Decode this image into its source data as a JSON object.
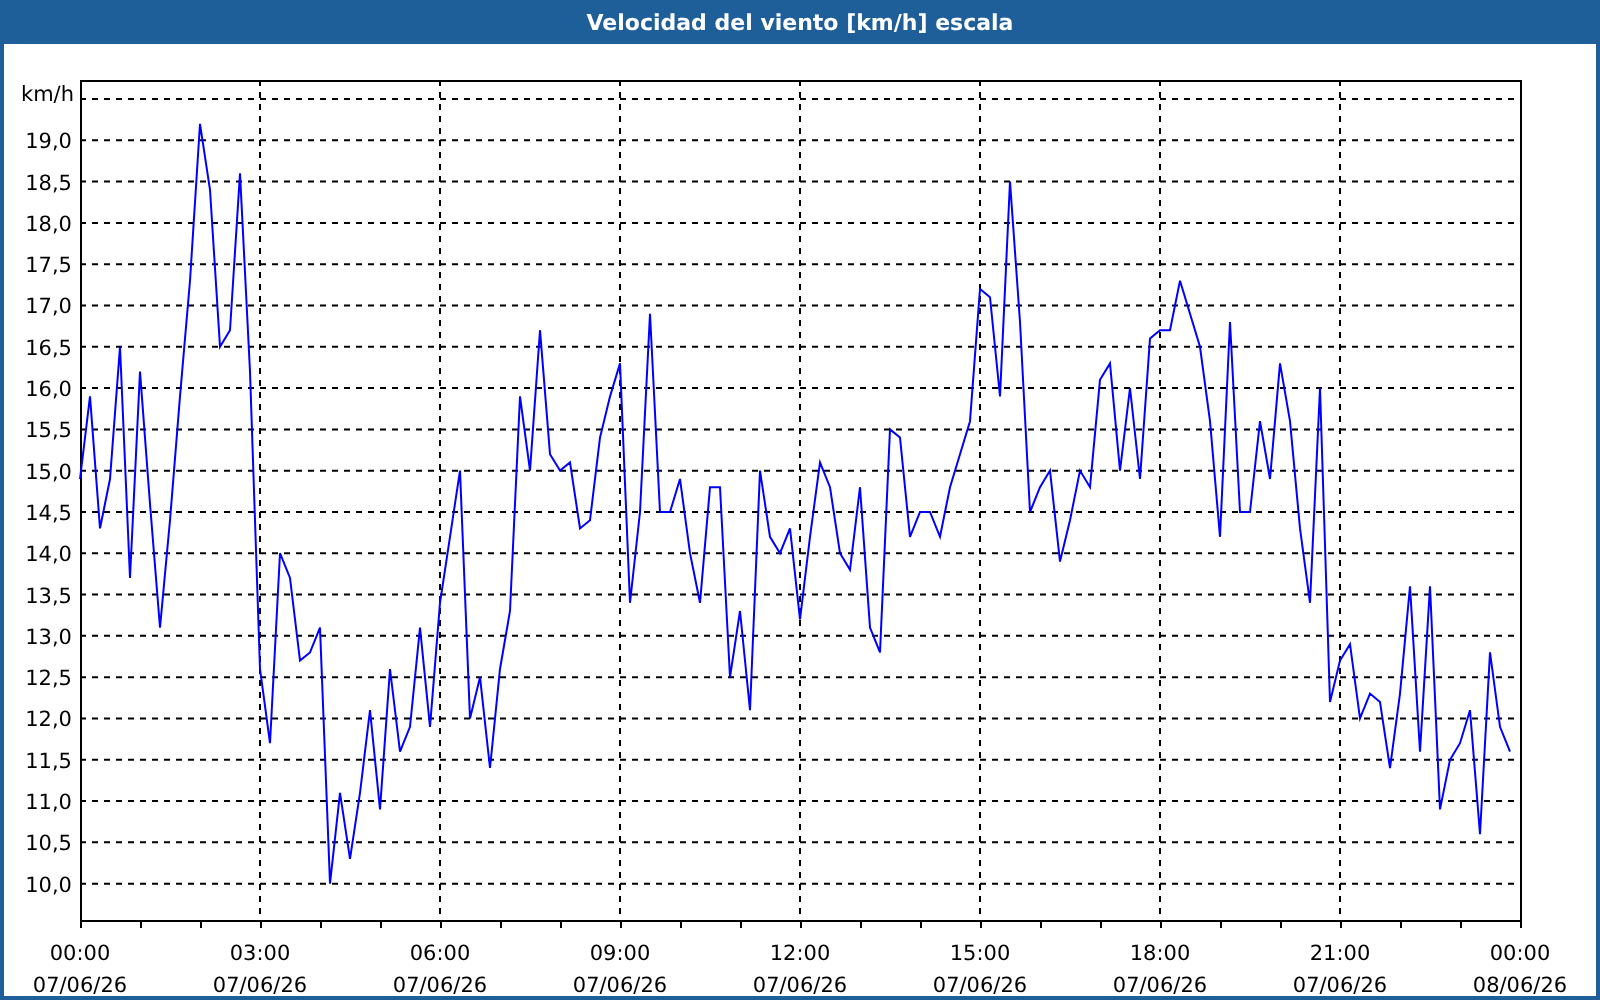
{
  "window": {
    "title": "Velocidad del viento [km/h] escala"
  },
  "chart": {
    "chart_data": {
      "type": "line",
      "grid": true,
      "ylabel": "km/h",
      "categories": [
        "00:00\n07/06/26",
        null,
        null,
        null,
        null,
        null,
        null,
        null,
        null,
        null,
        null,
        null,
        null,
        null,
        null,
        null,
        null,
        null,
        "03:00\n07/06/26",
        null,
        null,
        null,
        null,
        null,
        null,
        null,
        null,
        null,
        null,
        null,
        null,
        null,
        null,
        null,
        null,
        null,
        "06:00\n07/06/26",
        null,
        null,
        null,
        null,
        null,
        null,
        null,
        null,
        null,
        null,
        null,
        null,
        null,
        null,
        null,
        null,
        null,
        "09:00\n07/06/26",
        null,
        null,
        null,
        null,
        null,
        null,
        null,
        null,
        null,
        null,
        null,
        null,
        null,
        null,
        null,
        null,
        null,
        "12:00\n07/06/26",
        null,
        null,
        null,
        null,
        null,
        null,
        null,
        null,
        null,
        null,
        null,
        null,
        null,
        null,
        null,
        null,
        null,
        "15:00\n07/06/26",
        null,
        null,
        null,
        null,
        null,
        null,
        null,
        null,
        null,
        null,
        null,
        null,
        null,
        null,
        null,
        null,
        null,
        "18:00\n07/06/26",
        null,
        null,
        null,
        null,
        null,
        null,
        null,
        null,
        null,
        null,
        null,
        null,
        null,
        null,
        null,
        null,
        null,
        "21:00\n07/06/26",
        null,
        null,
        null,
        null,
        null,
        null,
        null,
        null,
        null,
        null,
        null,
        null,
        null,
        null,
        null,
        null,
        null,
        "00:00\n08/06/26"
      ],
      "series": [
        {
          "color": "#0000ff",
          "values": [
            14.9,
            15.9,
            14.3,
            14.9,
            16.5,
            13.7,
            16.2,
            14.6,
            13.1,
            14.4,
            15.9,
            17.3,
            19.2,
            18.4,
            16.5,
            16.7,
            18.6,
            16.2,
            12.6,
            11.7,
            14.0,
            13.7,
            12.7,
            12.8,
            13.1,
            10.0,
            11.1,
            10.3,
            11.1,
            12.1,
            10.9,
            12.6,
            11.6,
            11.9,
            13.1,
            11.9,
            13.4,
            14.2,
            15.0,
            12.0,
            12.5,
            11.4,
            12.6,
            13.3,
            15.9,
            15.0,
            16.7,
            15.2,
            15.0,
            15.1,
            14.3,
            14.4,
            15.4,
            15.9,
            16.3,
            13.4,
            14.5,
            16.9,
            14.5,
            14.5,
            14.9,
            14.0,
            13.4,
            14.8,
            14.8,
            12.5,
            13.3,
            12.1,
            15.0,
            14.2,
            14.0,
            14.3,
            13.2,
            14.2,
            15.1,
            14.8,
            14.0,
            13.8,
            14.8,
            13.1,
            12.8,
            15.5,
            15.4,
            14.2,
            14.5,
            14.5,
            14.2,
            14.8,
            15.2,
            15.6,
            17.2,
            17.1,
            15.9,
            18.5,
            16.8,
            14.5,
            14.8,
            15.0,
            13.9,
            14.4,
            15.0,
            14.8,
            16.1,
            16.3,
            15.0,
            16.0,
            14.9,
            16.6,
            16.7,
            16.7,
            17.3,
            16.9,
            16.5,
            15.6,
            14.2,
            16.8,
            14.5,
            14.5,
            15.6,
            14.9,
            16.3,
            15.6,
            14.3,
            13.4,
            16.0,
            12.2,
            12.7,
            12.9,
            12.0,
            12.3,
            12.2,
            11.4,
            12.3,
            13.6,
            11.6,
            13.6,
            10.9,
            11.5,
            11.7,
            12.1,
            10.6,
            12.8,
            11.9,
            11.6,
            null
          ]
        }
      ],
      "ylim": [
        9.56,
        19.73
      ],
      "yticks": [
        {
          "value": 10,
          "label": "10,0"
        },
        {
          "value": 10.5,
          "label": "10,5"
        },
        {
          "value": 11,
          "label": "11,0"
        },
        {
          "value": 11.5,
          "label": "11,5"
        },
        {
          "value": 12,
          "label": "12,0"
        },
        {
          "value": 12.5,
          "label": "12,5"
        },
        {
          "value": 13,
          "label": "13,0"
        },
        {
          "value": 13.5,
          "label": "13,5"
        },
        {
          "value": 14,
          "label": "14,0"
        },
        {
          "value": 14.5,
          "label": "14,5"
        },
        {
          "value": 15,
          "label": "15,0"
        },
        {
          "value": 15.5,
          "label": "15,5"
        },
        {
          "value": 16,
          "label": "16,0"
        },
        {
          "value": 16.5,
          "label": "16,5"
        },
        {
          "value": 17,
          "label": "17,0"
        },
        {
          "value": 17.5,
          "label": "17,5"
        },
        {
          "value": 18,
          "label": "18,0"
        },
        {
          "value": 18.5,
          "label": "18,5"
        },
        {
          "value": 19,
          "label": "19,0"
        }
      ]
    }
  }
}
